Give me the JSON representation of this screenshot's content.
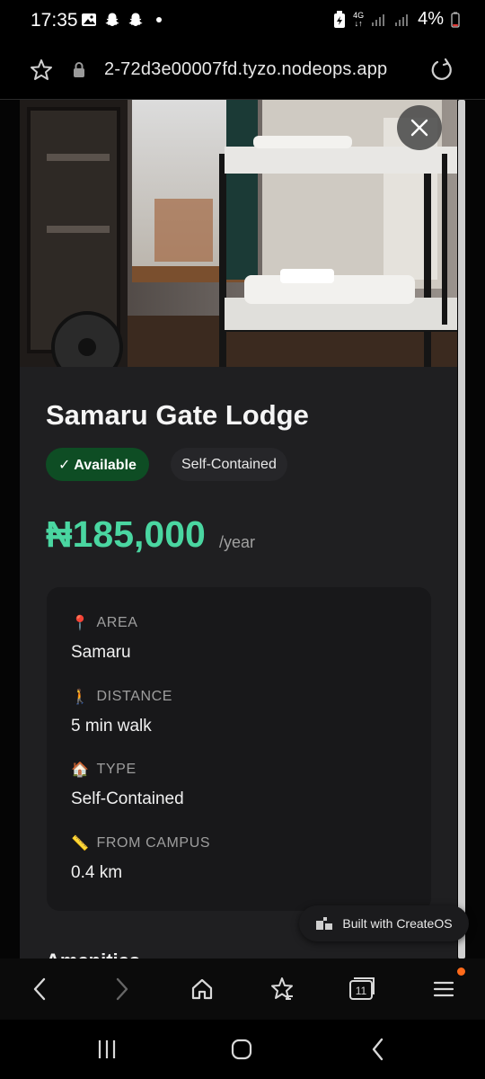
{
  "status_bar": {
    "time": "17:35",
    "network": "4G",
    "battery": "4%",
    "left_icons": [
      "gallery-icon",
      "snapchat-icon",
      "snapchat-icon",
      "dot-icon"
    ]
  },
  "browser": {
    "url": "2-72d3e00007fd.tyzo.nodeops.app",
    "tab_count": "11"
  },
  "listing": {
    "title": "Samaru Gate Lodge",
    "availability": "✓ Available",
    "type_badge": "Self-Contained",
    "price": "₦185,000",
    "price_period": "/year",
    "details": [
      {
        "icon": "📍",
        "label": "AREA",
        "value": "Samaru"
      },
      {
        "icon": "🚶",
        "label": "DISTANCE",
        "value": "5 min walk"
      },
      {
        "icon": "🏠",
        "label": "TYPE",
        "value": "Self-Contained"
      },
      {
        "icon": "📏",
        "label": "FROM CAMPUS",
        "value": "0.4 km"
      }
    ],
    "amenities_heading": "Amenities"
  },
  "createos_badge": "Built with CreateOS",
  "colors": {
    "accent_price": "#4ad6a1",
    "available_badge": "#0e4d24",
    "card_bg": "#1f1f21",
    "notification_dot": "#ff6a1a"
  }
}
